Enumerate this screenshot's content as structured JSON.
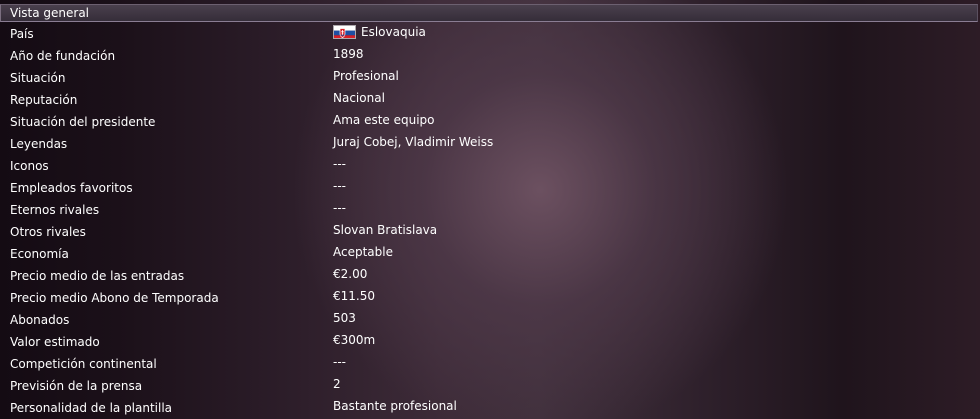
{
  "panel": {
    "title": "Vista general"
  },
  "rows": [
    {
      "label": "País",
      "value": "Eslovaquia",
      "icon": "slovakia-flag-icon"
    },
    {
      "label": "Año de fundación",
      "value": "1898"
    },
    {
      "label": "Situación",
      "value": "Profesional"
    },
    {
      "label": "Reputación",
      "value": "Nacional"
    },
    {
      "label": "Situación del presidente",
      "value": "Ama este equipo"
    },
    {
      "label": "Leyendas",
      "value": "Juraj Cobej, Vladimir Weiss"
    },
    {
      "label": "Iconos",
      "value": "---"
    },
    {
      "label": "Empleados favoritos",
      "value": "---"
    },
    {
      "label": "Eternos rivales",
      "value": "---"
    },
    {
      "label": "Otros rivales",
      "value": "Slovan Bratislava"
    },
    {
      "label": "Economía",
      "value": "Aceptable"
    },
    {
      "label": "Precio medio de las entradas",
      "value": "€2.00"
    },
    {
      "label": "Precio medio Abono de Temporada",
      "value": "€11.50"
    },
    {
      "label": "Abonados",
      "value": "503"
    },
    {
      "label": "Valor estimado",
      "value": "€300m"
    },
    {
      "label": "Competición continental",
      "value": "---"
    },
    {
      "label": "Previsión de la prensa",
      "value": "2"
    },
    {
      "label": "Personalidad de la plantilla",
      "value": "Bastante profesional"
    }
  ],
  "colors": {
    "text": "#ffffff",
    "header_bg": "#403744",
    "flag_white": "#ffffff",
    "flag_blue": "#1f4fa3",
    "flag_red": "#d81f26"
  }
}
